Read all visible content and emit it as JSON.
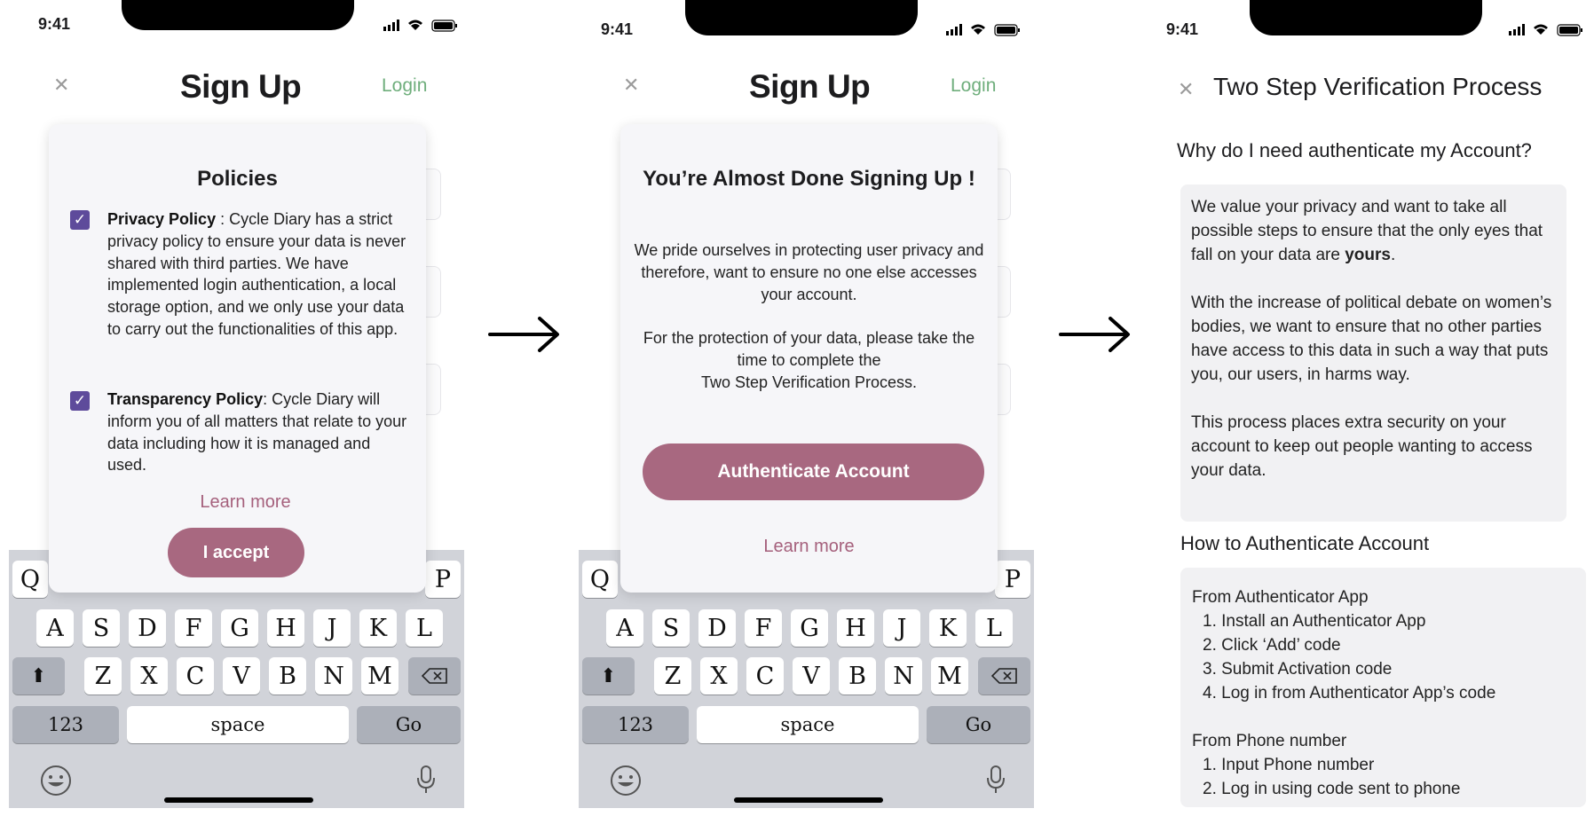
{
  "screen1": {
    "status_time": "9:41",
    "close": "✕",
    "title": "Sign Up",
    "login": "Login",
    "modal": {
      "heading": "Policies",
      "privacy_label": "Privacy Policy",
      "privacy_text": " : Cycle Diary has a strict privacy policy to ensure your data is never shared with third parties. We have implemented login authentication, a local storage option, and we only use your data to carry out the functionalities of this app.",
      "transparency_label": "Transparency Policy",
      "transparency_text": ": Cycle Diary will inform you of all matters that relate to your data including how it is managed and used.",
      "learn_more": "Learn more",
      "accept": "I accept"
    }
  },
  "screen2": {
    "status_time": "9:41",
    "close": "✕",
    "title": "Sign Up",
    "login": "Login",
    "modal": {
      "heading": "You’re Almost Done Signing Up !",
      "para1": "We pride ourselves in protecting user privacy and therefore, want to ensure no one else accesses your account.",
      "para2_line1": "For the protection of your data, please take the time to complete the",
      "para2_line2": "Two Step Verification Process.",
      "auth_button": "Authenticate Account",
      "learn_more": "Learn more"
    }
  },
  "keyboard": {
    "row_top_visible": [
      "Q",
      "P"
    ],
    "row2": [
      "A",
      "S",
      "D",
      "F",
      "G",
      "H",
      "J",
      "K",
      "L"
    ],
    "row3": [
      "Z",
      "X",
      "C",
      "V",
      "B",
      "N",
      "M"
    ],
    "numbers": "123",
    "space": "space",
    "go": "Go"
  },
  "screen3": {
    "status_time": "9:41",
    "close": "✕",
    "title": "Two Step Verification Process",
    "why_heading": "Why do I need authenticate my Account?",
    "p1_text": "We value your privacy and want to take all possible steps to ensure that the only eyes that fall on your data are ",
    "p1_bold": "yours",
    "p1_end": ".",
    "p2": "With the increase of political debate on women’s bodies, we want to ensure that no other parties have access to this data in such a way that puts you, our users, in harms way.",
    "p3": "This process places extra security on your account to keep out people wanting to access your data.",
    "how_heading": "How to Authenticate Account",
    "app_heading": "From Authenticator App",
    "app_steps": [
      "1. Install an Authenticator App",
      "2. Click ‘Add’ code",
      "3. Submit Activation code",
      "4. Log in from Authenticator App’s code"
    ],
    "phone_heading": "From Phone number",
    "phone_steps": [
      "1. Input Phone number",
      "2. Log in using code sent to phone"
    ]
  },
  "colors": {
    "accent_mauve": "#a86880",
    "login_green": "#6fae7c",
    "checkbox_purple": "#5e4b9b",
    "keyboard_gray": "#d1d3d9"
  }
}
